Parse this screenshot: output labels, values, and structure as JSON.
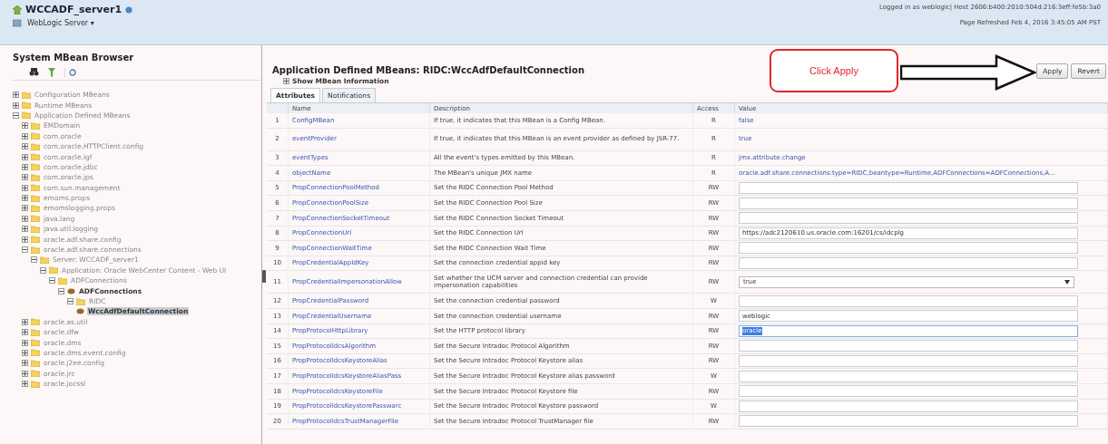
{
  "header": {
    "server": "WCCADF_server1",
    "menu": "WebLogic Server ▾",
    "login": "Logged in as weblogic| Host 2606:b400:2010:504d:216:3eff:fe5b:3a0",
    "refreshed": "Page Refreshed Feb 4, 2016 3:45:05 AM PST"
  },
  "sidebar": {
    "title": "System MBean Browser",
    "tree": [
      {
        "label": "Configuration MBeans",
        "kind": "folder",
        "expanded": false,
        "selected": false
      },
      {
        "label": "Runtime MBeans",
        "kind": "folder",
        "expanded": false,
        "selected": false
      },
      {
        "label": "Application Defined MBeans",
        "kind": "folder",
        "expanded": true,
        "selected": false,
        "children": [
          {
            "label": "EMDomain",
            "kind": "folder",
            "expanded": false,
            "selected": false
          },
          {
            "label": "com.oracle",
            "kind": "folder",
            "expanded": false,
            "selected": false
          },
          {
            "label": "com.oracle.HTTPClient.config",
            "kind": "folder",
            "expanded": false,
            "selected": false
          },
          {
            "label": "com.oracle.igf",
            "kind": "folder",
            "expanded": false,
            "selected": false
          },
          {
            "label": "com.oracle.jdbc",
            "kind": "folder",
            "expanded": false,
            "selected": false
          },
          {
            "label": "com.oracle.jps",
            "kind": "folder",
            "expanded": false,
            "selected": false
          },
          {
            "label": "com.sun.management",
            "kind": "folder",
            "expanded": false,
            "selected": false
          },
          {
            "label": "emoms.props",
            "kind": "folder",
            "expanded": false,
            "selected": false
          },
          {
            "label": "emomslogging.props",
            "kind": "folder",
            "expanded": false,
            "selected": false
          },
          {
            "label": "java.lang",
            "kind": "folder",
            "expanded": false,
            "selected": false
          },
          {
            "label": "java.util.logging",
            "kind": "folder",
            "expanded": false,
            "selected": false
          },
          {
            "label": "oracle.adf.share.config",
            "kind": "folder",
            "expanded": false,
            "selected": false
          },
          {
            "label": "oracle.adf.share.connections",
            "kind": "folder",
            "expanded": true,
            "selected": false,
            "children": [
              {
                "label": "Server: WCCADF_server1",
                "kind": "folder",
                "expanded": true,
                "selected": false,
                "children": [
                  {
                    "label": "Application: Oracle WebCenter Content - Web UI",
                    "kind": "folder",
                    "expanded": true,
                    "selected": false,
                    "children": [
                      {
                        "label": "ADFConnections",
                        "kind": "folder",
                        "expanded": true,
                        "selected": false,
                        "children": [
                          {
                            "label": "ADFConnections",
                            "kind": "bean",
                            "expanded": true,
                            "selected": false,
                            "children": [
                              {
                                "label": "RIDC",
                                "kind": "folder",
                                "expanded": true,
                                "selected": false,
                                "children": [
                                  {
                                    "label": "WccAdfDefaultConnection",
                                    "kind": "bean",
                                    "selected": true
                                  }
                                ]
                              }
                            ]
                          }
                        ]
                      }
                    ]
                  }
                ]
              }
            ]
          },
          {
            "label": "oracle.as.util",
            "kind": "folder",
            "expanded": false,
            "selected": false
          },
          {
            "label": "oracle.dfw",
            "kind": "folder",
            "expanded": false,
            "selected": false
          },
          {
            "label": "oracle.dms",
            "kind": "folder",
            "expanded": false,
            "selected": false
          },
          {
            "label": "oracle.dms.event.config",
            "kind": "folder",
            "expanded": false,
            "selected": false
          },
          {
            "label": "oracle.j2ee.config",
            "kind": "folder",
            "expanded": false,
            "selected": false
          },
          {
            "label": "oracle.jrc",
            "kind": "folder",
            "expanded": false,
            "selected": false
          },
          {
            "label": "oracle.jocssl",
            "kind": "folder",
            "expanded": false,
            "selected": false
          }
        ]
      }
    ]
  },
  "main": {
    "title": "Application Defined MBeans: RIDC:WccAdfDefaultConnection",
    "show_info": "Show MBean Information",
    "callout": "Click Apply",
    "buttons": [
      "Apply",
      "Revert"
    ],
    "tabs": [
      {
        "label": "Attributes",
        "selected": true
      },
      {
        "label": "Notifications",
        "selected": false
      }
    ],
    "table": {
      "columns": [
        "Name",
        "Description",
        "Access",
        "Value"
      ],
      "rows": [
        {
          "n": "1",
          "name": "ConfigMBean",
          "desc": "If true, it indicates that this MBean is a Config MBean.",
          "access": "R",
          "value": {
            "kind": "link",
            "text": "false"
          }
        },
        {
          "n": "2",
          "name": "eventProvider",
          "desc": "If true, it indicates that this MBean is an event provider as defined by JSR-77.",
          "access": "R",
          "value": {
            "kind": "link",
            "text": "true"
          }
        },
        {
          "n": "3",
          "name": "eventTypes",
          "desc": "All the event's types emitted by this MBean.",
          "access": "R",
          "value": {
            "kind": "link",
            "text": "jmx.attribute.change"
          }
        },
        {
          "n": "4",
          "name": "objectName",
          "desc": "The MBean's unique JMX name",
          "access": "R",
          "value": {
            "kind": "link",
            "text": "oracle.adf.share.connections:type=RIDC,beantype=Runtime,ADFConnections=ADFConnections,A..."
          }
        },
        {
          "n": "5",
          "name": "PropConnectionPoolMethod",
          "desc": "Set the RIDC Connection Pool Method",
          "access": "RW",
          "value": {
            "kind": "input",
            "highlighted": false
          }
        },
        {
          "n": "6",
          "name": "PropConnectionPoolSize",
          "desc": "Set the RIDC Connection Pool Size",
          "access": "RW",
          "value": {
            "kind": "input",
            "highlighted": false
          }
        },
        {
          "n": "7",
          "name": "PropConnectionSocketTimeout",
          "desc": "Set the RIDC Connection Socket Timeout",
          "access": "RW",
          "value": {
            "kind": "input",
            "highlighted": false
          }
        },
        {
          "n": "8",
          "name": "PropConnectionUrl",
          "desc": "Set the RIDC Connection Url",
          "access": "RW",
          "value": {
            "kind": "input",
            "text": "https://adc2120610.us.oracle.com:16201/cs/idcplg",
            "highlighted": false
          }
        },
        {
          "n": "9",
          "name": "PropConnectionWaitTime",
          "desc": "Set the RIDC Connection Wait Time",
          "access": "RW",
          "value": {
            "kind": "input",
            "highlighted": false
          }
        },
        {
          "n": "10",
          "name": "PropCredentialAppIdKey",
          "desc": "Set the connection credential appid key",
          "access": "RW",
          "value": {
            "kind": "input",
            "highlighted": false
          }
        },
        {
          "n": "11",
          "name": "PropCredentialImpersonationAllow",
          "desc": "Set whether the UCM server and connection credential can provide impersonation capabilities",
          "access": "RW",
          "value": {
            "kind": "select",
            "text": "true"
          }
        },
        {
          "n": "12",
          "name": "PropCredentialPassword",
          "desc": "Set the connection credential password",
          "access": "W",
          "value": {
            "kind": "input",
            "highlighted": false
          }
        },
        {
          "n": "13",
          "name": "PropCredentialUsername",
          "desc": "Set the connection credential username",
          "access": "RW",
          "value": {
            "kind": "input",
            "text": "weblogic",
            "highlighted": false
          }
        },
        {
          "n": "14",
          "name": "PropProtocolHttpLibrary",
          "desc": "Set the HTTP protocol library",
          "access": "RW",
          "value": {
            "kind": "input",
            "text": "oracle",
            "highlighted": true
          }
        },
        {
          "n": "15",
          "name": "PropProtocolIdcsAlgorithm",
          "desc": "Set the Secure Intradoc Protocol Algorithm",
          "access": "RW",
          "value": {
            "kind": "input",
            "highlighted": false
          }
        },
        {
          "n": "16",
          "name": "PropProtocolIdcsKeystoreAlias",
          "desc": "Set the Secure Intradoc Protocol Keystore alias",
          "access": "RW",
          "value": {
            "kind": "input",
            "highlighted": false
          }
        },
        {
          "n": "17",
          "name": "PropProtocolIdcsKeystoreAliasPass",
          "desc": "Set the Secure Intradoc Protocol Keystore alias password",
          "access": "W",
          "value": {
            "kind": "input",
            "highlighted": false
          }
        },
        {
          "n": "18",
          "name": "PropProtocolIdcsKeystoreFile",
          "desc": "Set the Secure Intradoc Protocol Keystore file",
          "access": "RW",
          "value": {
            "kind": "input",
            "highlighted": false
          }
        },
        {
          "n": "19",
          "name": "PropProtocolIdcsKeystorePasswarc",
          "desc": "Set the Secure Intradoc Protocol Keystore password",
          "access": "W",
          "value": {
            "kind": "input",
            "highlighted": false
          }
        },
        {
          "n": "20",
          "name": "PropProtocolIdcsTrustManagerFile",
          "desc": "Set the Secure Intradoc Protocol TrustManager file",
          "access": "RW",
          "value": {
            "kind": "input",
            "highlighted": false
          }
        }
      ]
    }
  }
}
